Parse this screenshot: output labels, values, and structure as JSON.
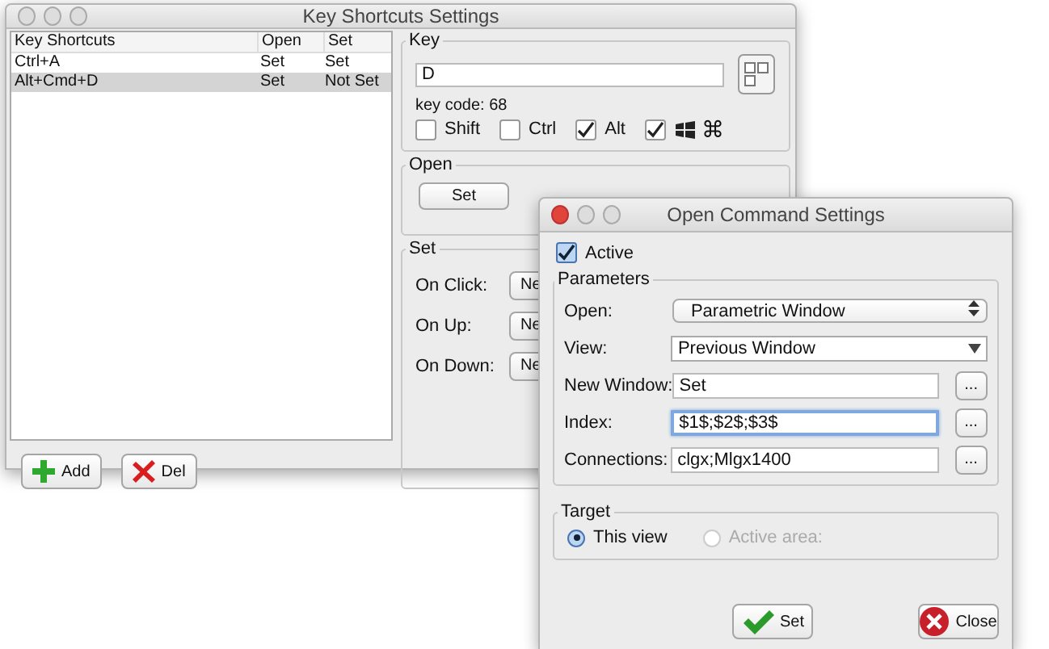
{
  "main_window": {
    "title": "Key Shortcuts Settings",
    "table": {
      "columns": [
        "Key Shortcuts",
        "Open",
        "Set"
      ],
      "rows": [
        {
          "cells": [
            "Ctrl+A",
            "Set",
            "Set"
          ],
          "selected": false
        },
        {
          "cells": [
            "Alt+Cmd+D",
            "Set",
            "Not Set"
          ],
          "selected": true
        }
      ]
    },
    "buttons": [
      {
        "label": "Add",
        "kind": "add"
      },
      {
        "label": "Del",
        "kind": "delete"
      }
    ],
    "key_group": {
      "title": "Key",
      "value": "D",
      "key_code": "key code: 68",
      "modifiers": [
        {
          "label": "Shift",
          "checked": false,
          "kind": "text"
        },
        {
          "label": "Ctrl",
          "checked": false,
          "kind": "text"
        },
        {
          "label": "Alt",
          "checked": true,
          "kind": "text"
        },
        {
          "label": "⌘",
          "checked": true,
          "kind": "command"
        }
      ]
    },
    "open_group": {
      "title": "Open",
      "button": "Set"
    },
    "set_group": {
      "title": "Set",
      "rows": [
        {
          "label": "On Click:",
          "button": "Ne"
        },
        {
          "label": "On Up:",
          "button": "Ne"
        },
        {
          "label": "On Down:",
          "button": "Ne"
        }
      ]
    }
  },
  "dialog": {
    "title": "Open Command Settings",
    "active": {
      "label": "Active",
      "checked": true
    },
    "parameters": {
      "title": "Parameters",
      "rows": [
        {
          "kind": "popup",
          "label": "Open:",
          "value": "Parametric Window"
        },
        {
          "kind": "combo",
          "label": "View:",
          "value": "Previous Window"
        },
        {
          "kind": "field",
          "label": "New Window:",
          "value": "Set",
          "button": "...",
          "focused": false
        },
        {
          "kind": "field",
          "label": "Index:",
          "value": "$1$;$2$;$3$",
          "button": "...",
          "focused": true
        },
        {
          "kind": "field",
          "label": "Connections:",
          "value": "clgx;Mlgx1400",
          "button": "...",
          "focused": false
        }
      ]
    },
    "target": {
      "title": "Target",
      "options": [
        {
          "label": "This view",
          "selected": true,
          "disabled": false
        },
        {
          "label": "Active area:",
          "selected": false,
          "disabled": true
        }
      ]
    },
    "buttons": [
      {
        "label": "Set",
        "kind": "ok"
      },
      {
        "label": "Close",
        "kind": "close"
      }
    ]
  }
}
